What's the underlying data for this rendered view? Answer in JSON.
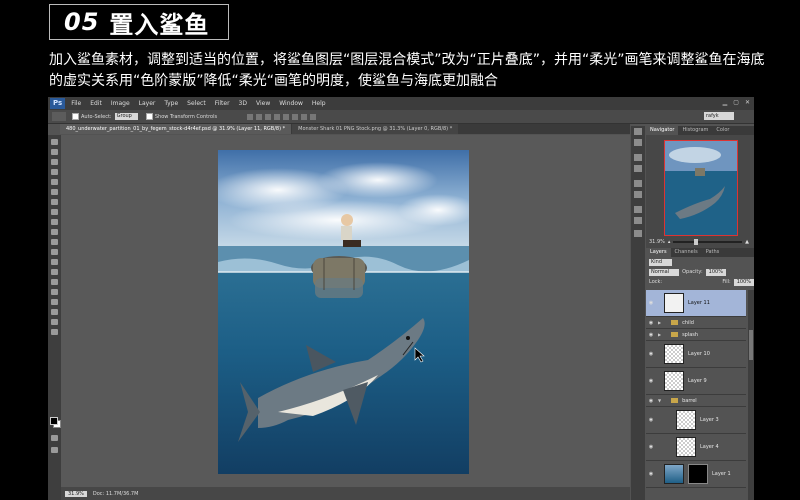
{
  "header": {
    "step_number": "05",
    "step_title": "置入鲨鱼",
    "description": "加入鲨鱼素材，调整到适当的位置，将鲨鱼图层“图层混合模式”改为“正片叠底”，并用“柔光”画笔来调整鲨鱼在海底的虚实关系用“色阶蒙版”降低“柔光“画笔的明度，使鲨鱼与海底更加融合"
  },
  "photoshop": {
    "logo": "Ps",
    "menu": [
      "File",
      "Edit",
      "Image",
      "Layer",
      "Type",
      "Select",
      "Filter",
      "3D",
      "View",
      "Window",
      "Help"
    ],
    "options_bar": {
      "auto_select_label": "Auto-Select:",
      "auto_select_value": "Group",
      "show_transform_label": "Show Transform Controls",
      "workspace": "rafyk"
    },
    "doc_tabs": [
      {
        "label": "480_underwater_partition_01_by_fegem_stock-d4r4ef.psd @ 31.9% (Layer 11, RGB/8) *",
        "active": true
      },
      {
        "label": "Monster Shark 01 PNG Stock.png @ 31.3% (Layer 0, RGB/8) *",
        "active": false
      }
    ],
    "status": {
      "zoom": "31.9%",
      "doc_info": "Doc: 11.7M/36.7M"
    },
    "navigator": {
      "tabs": [
        "Navigator",
        "Histogram",
        "Color"
      ],
      "zoom": "31.9%"
    },
    "layers_panel": {
      "tabs": [
        "Layers",
        "Channels",
        "Paths"
      ],
      "kind": "Kind",
      "blend_mode": "Normal",
      "opacity_label": "Opacity:",
      "opacity": "100%",
      "fill_label": "Fill:",
      "fill": "100%",
      "lock_label": "Lock:",
      "layers": [
        {
          "name": "Layer 11",
          "type": "layer",
          "selected": true
        },
        {
          "name": "child",
          "type": "group",
          "selected": false
        },
        {
          "name": "splash",
          "type": "group",
          "selected": false
        },
        {
          "name": "Layer 10",
          "type": "layer",
          "selected": false
        },
        {
          "name": "Layer 9",
          "type": "layer",
          "selected": false
        },
        {
          "name": "barrel",
          "type": "group-open",
          "selected": false
        },
        {
          "name": "Layer 3",
          "type": "layer-indent",
          "selected": false
        },
        {
          "name": "Layer 4",
          "type": "layer-indent",
          "selected": false
        },
        {
          "name": "Layer 1",
          "type": "layer-mask",
          "selected": false
        }
      ]
    }
  },
  "watermark": "rafyk"
}
